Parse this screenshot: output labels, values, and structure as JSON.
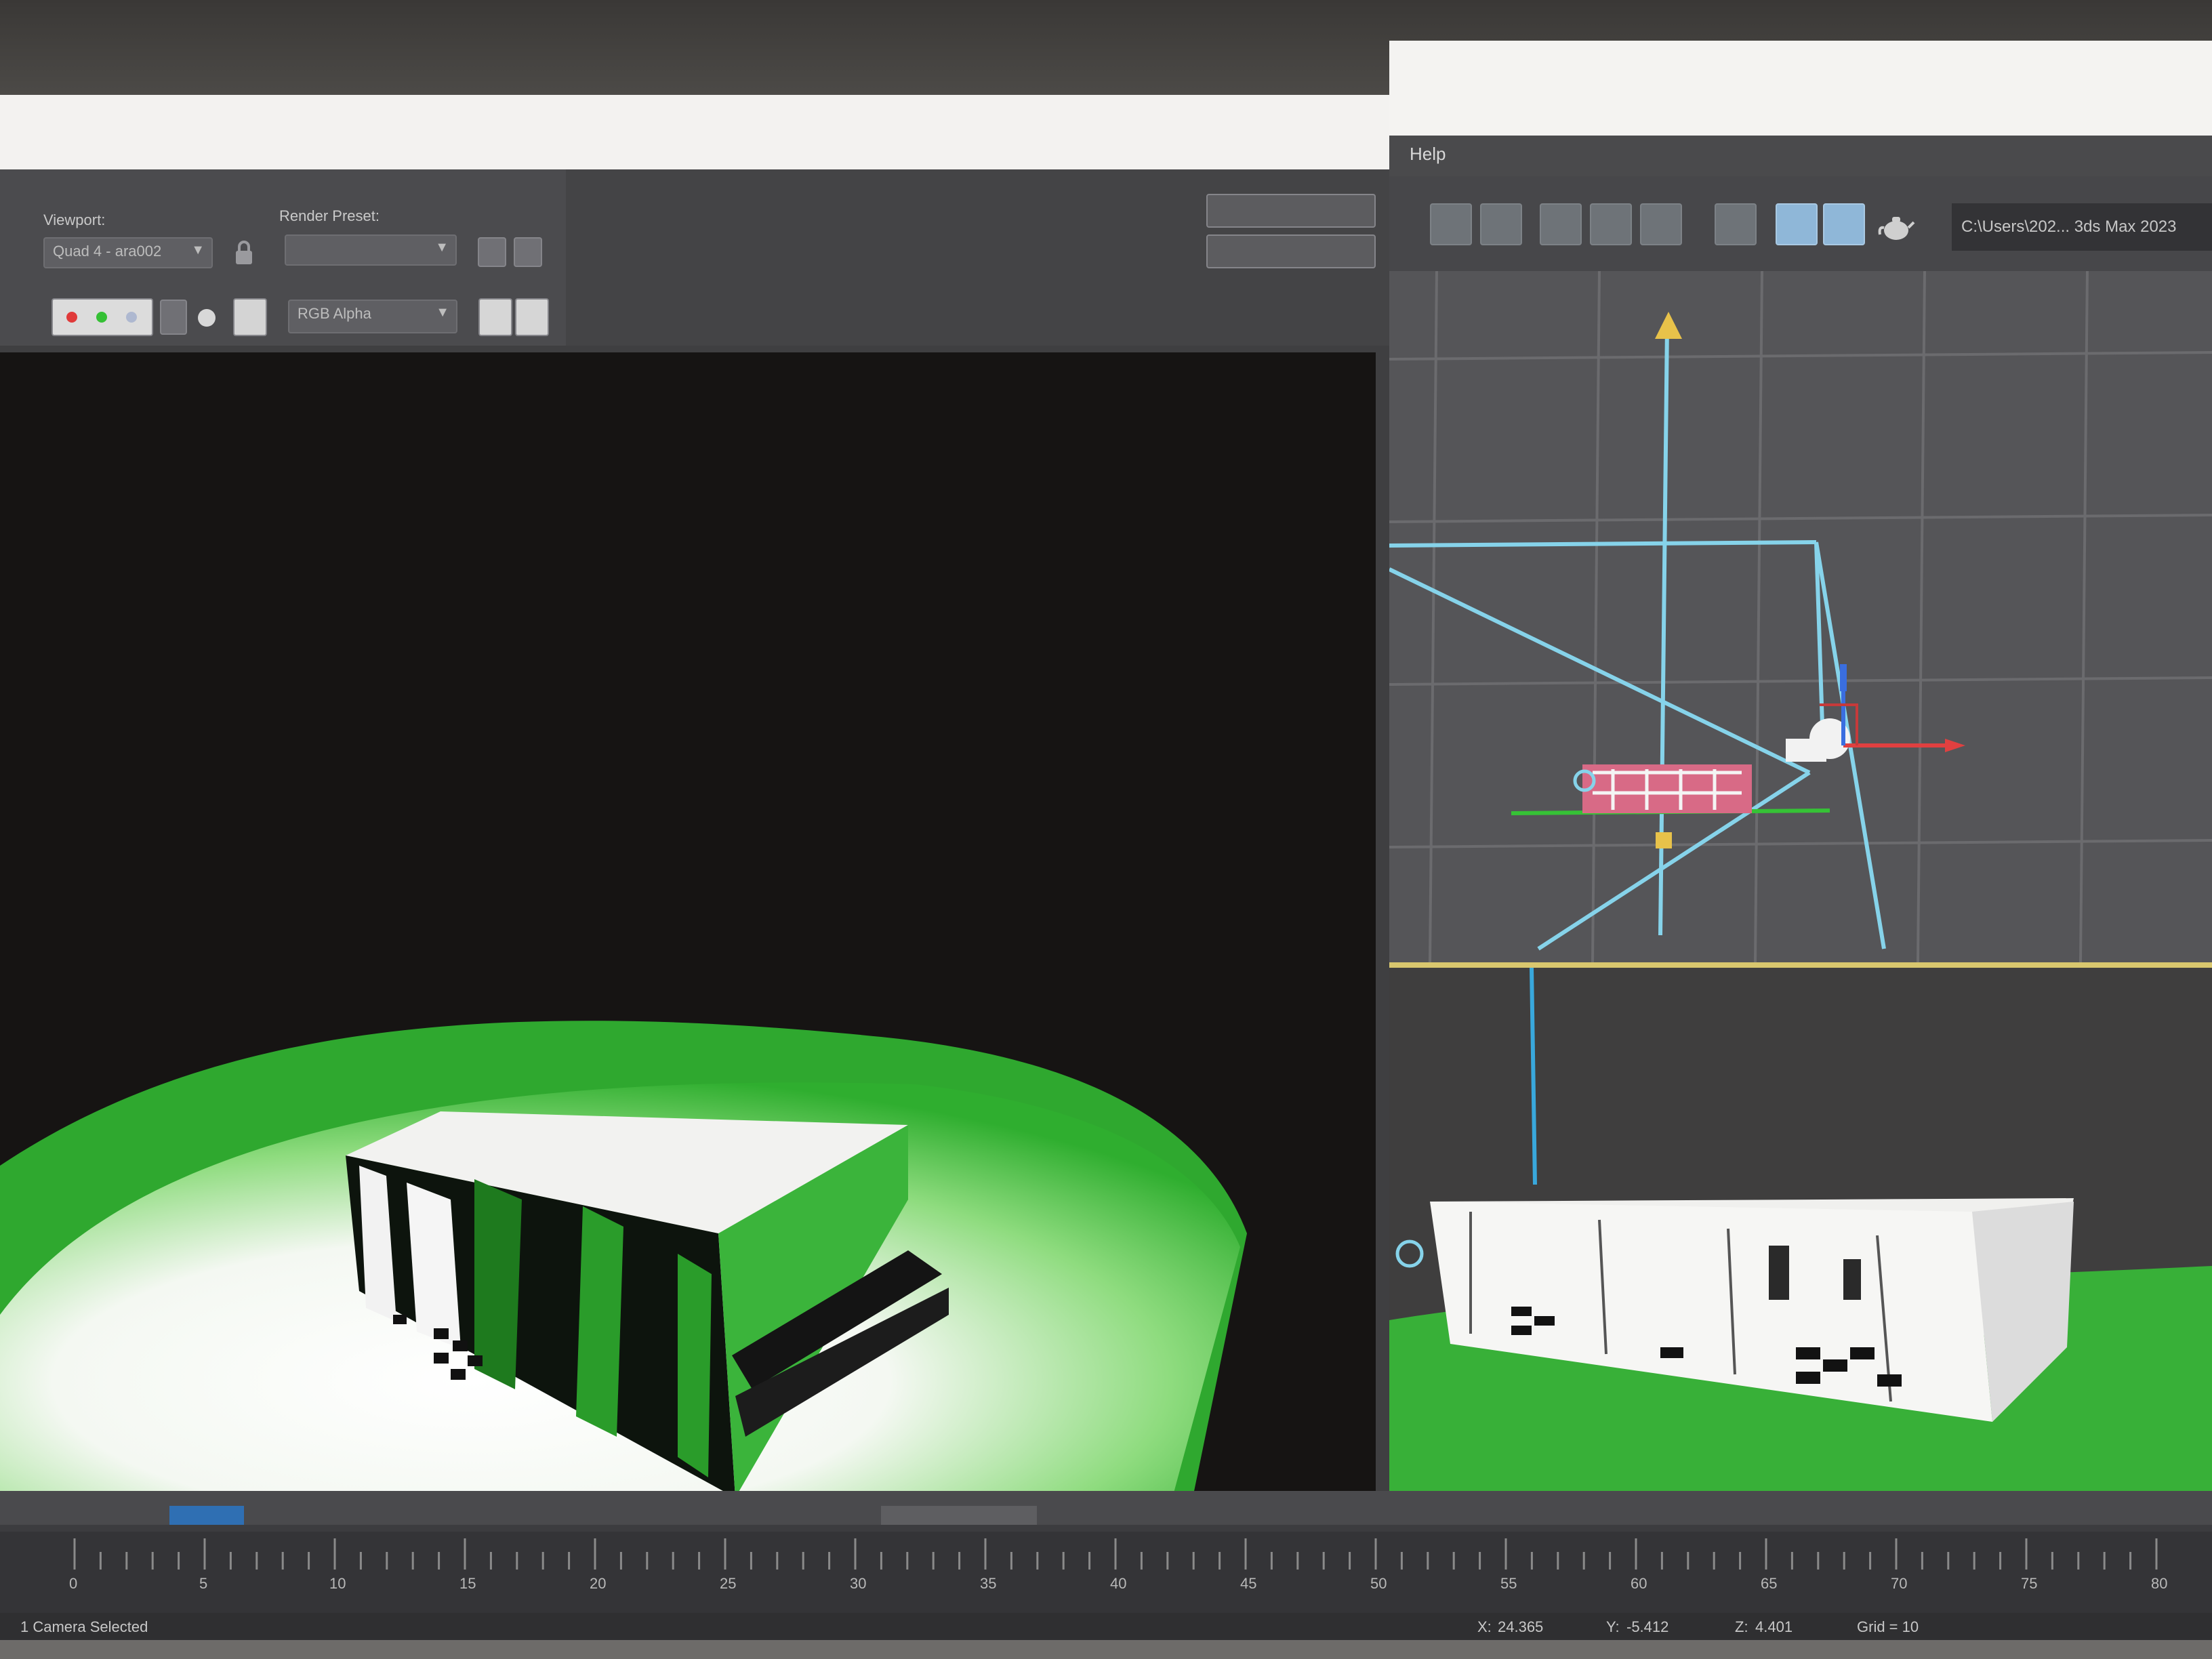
{
  "render_frame": {
    "viewport_label": "Viewport:",
    "viewport_value": "Quad 4 - ara002",
    "render_preset_label": "Render Preset:",
    "render_preset_value": "",
    "channel_value": "RGB Alpha"
  },
  "max_ui": {
    "menu_item": "Help",
    "path": "C:\\Users\\202... 3ds Max 2023"
  },
  "timeline": {
    "ticks": [
      "0",
      "5",
      "10",
      "15",
      "20",
      "25",
      "30",
      "35",
      "40",
      "45",
      "50",
      "55",
      "60",
      "65",
      "70",
      "75",
      "80"
    ]
  },
  "status": {
    "selection": "1 Camera Selected",
    "x_label": "X:",
    "x_value": "24.365",
    "y_label": "Y:",
    "y_value": "-5.412",
    "z_label": "Z:",
    "z_value": "4.401",
    "grid": "Grid = 10"
  },
  "colors": {
    "ground_green": "#2fae2f",
    "house_white": "#f4f4f2",
    "gizmo_cyan": "#7fd3e8",
    "render_bg": "#161413"
  },
  "icons": [
    "lock-icon",
    "red-dot-icon",
    "green-dot-icon",
    "clone-icon",
    "teapot-icon",
    "camera-icon",
    "target-icon"
  ]
}
